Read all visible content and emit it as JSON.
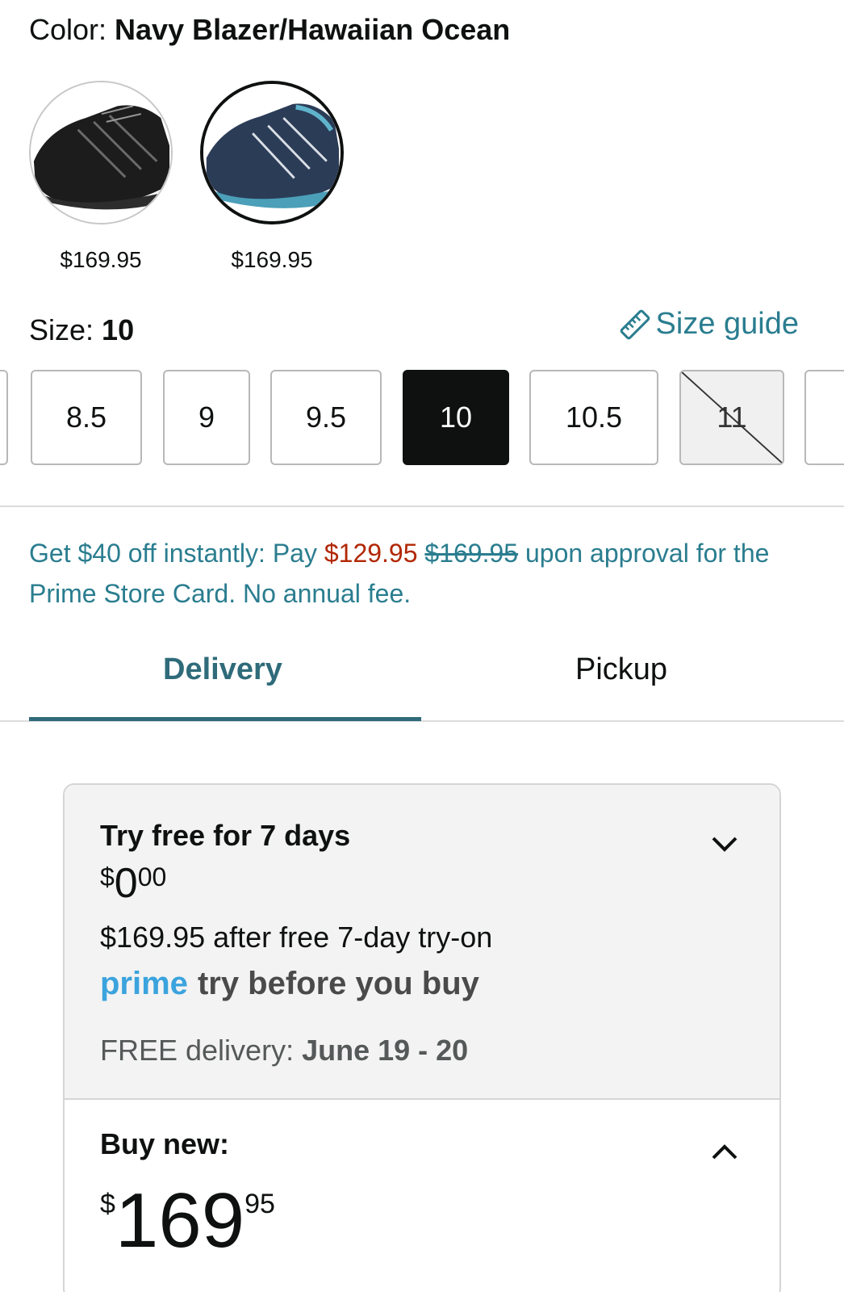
{
  "color": {
    "label": "Color: ",
    "value": "Navy Blazer/Hawaiian Ocean"
  },
  "swatches": [
    {
      "name": "black-shoe",
      "price": "$169.95"
    },
    {
      "name": "navy-shoe",
      "price": "$169.95"
    }
  ],
  "size": {
    "label": "Size: ",
    "value": "10",
    "guide_label": "Size guide"
  },
  "sizes": [
    "8.5",
    "9",
    "9.5",
    "10",
    "10.5",
    "11"
  ],
  "promo": {
    "prefix": "Get $40 off instantly: Pay ",
    "new_price": "$129.95",
    "old_price": "$169.95",
    "suffix": " upon approval for the Prime Store Card. No annual fee."
  },
  "tabs": {
    "delivery": "Delivery",
    "pickup": "Pickup"
  },
  "try_offer": {
    "title": "Try free for 7 days",
    "price_symbol": "$",
    "price_whole": "0",
    "price_frac": "00",
    "after_text": "$169.95 after free 7-day try-on",
    "prime_word": "prime",
    "prime_tagline": "try before you buy",
    "delivery_label": "FREE delivery: ",
    "delivery_date": "June 19 - 20"
  },
  "buy_new": {
    "label": "Buy new:",
    "price_symbol": "$",
    "price_whole": "169",
    "price_frac": "95"
  },
  "colors": {
    "teal_link": "#2a7d8f",
    "tab_active": "#2f6b7a",
    "deal_red": "#b12704",
    "prime_blue": "#3ba3dd"
  }
}
